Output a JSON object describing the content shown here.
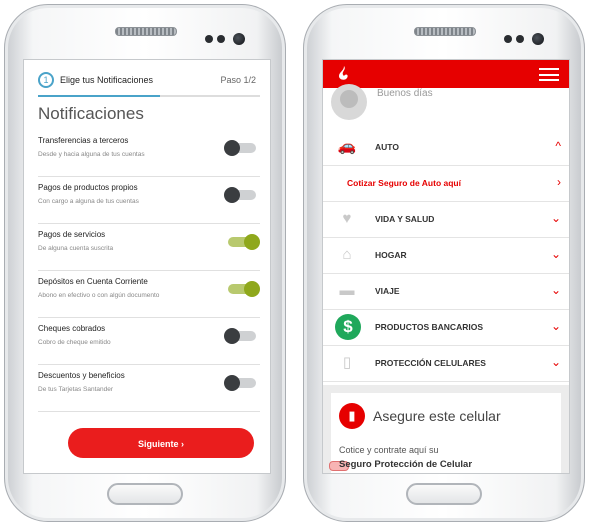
{
  "left_screen": {
    "step_number": "1",
    "step_title": "Elige tus Notificaciones",
    "step_counter": "Paso 1/2",
    "progress": 0.55,
    "heading": "Notificaciones",
    "items": [
      {
        "title": "Transferencias a terceros",
        "subtitle": "Desde y hacia alguna de tus cuentas",
        "enabled": false
      },
      {
        "title": "Pagos de productos propios",
        "subtitle": "Con cargo a alguna de tus cuentas",
        "enabled": false
      },
      {
        "title": "Pagos de servicios",
        "subtitle": "De alguna cuenta suscrita",
        "enabled": true
      },
      {
        "title": "Depósitos en Cuenta Corriente",
        "subtitle": "Abono en efectivo o con algún documento",
        "enabled": true
      },
      {
        "title": "Cheques cobrados",
        "subtitle": "Cobro de cheque emitido",
        "enabled": false
      },
      {
        "title": "Descuentos y beneficios",
        "subtitle": "De tus Tarjetas Santander",
        "enabled": false
      }
    ],
    "next_button": "Siguiente  ›",
    "colors": {
      "accent": "#4aa3c9",
      "toggle_on": "#8fa81c",
      "button": "#ea1d1d"
    }
  },
  "right_screen": {
    "greeting": "Buenos días",
    "menu": [
      {
        "label": "AUTO",
        "icon": "car-icon",
        "chevron": "^"
      },
      {
        "label": "Cotizar Seguro de Auto aquí",
        "icon": "",
        "chevron": "›",
        "link": true
      },
      {
        "label": "VIDA Y SALUD",
        "icon": "heart-icon",
        "chevron": "⌄"
      },
      {
        "label": "HOGAR",
        "icon": "house-icon",
        "chevron": "⌄"
      },
      {
        "label": "VIAJE",
        "icon": "suitcase-icon",
        "chevron": "⌄"
      },
      {
        "label": "PRODUCTOS BANCARIOS",
        "icon": "dollar-icon",
        "chevron": "⌄"
      },
      {
        "label": "PROTECCIÓN CELULARES",
        "icon": "mobile-icon",
        "chevron": "⌄"
      }
    ],
    "card": {
      "title": "Asegure este celular",
      "subtitle": "Cotice y contrate aquí su",
      "product": "Seguro Protección de Celular"
    },
    "colors": {
      "brand": "#e60000",
      "money": "#1fa85b"
    }
  }
}
